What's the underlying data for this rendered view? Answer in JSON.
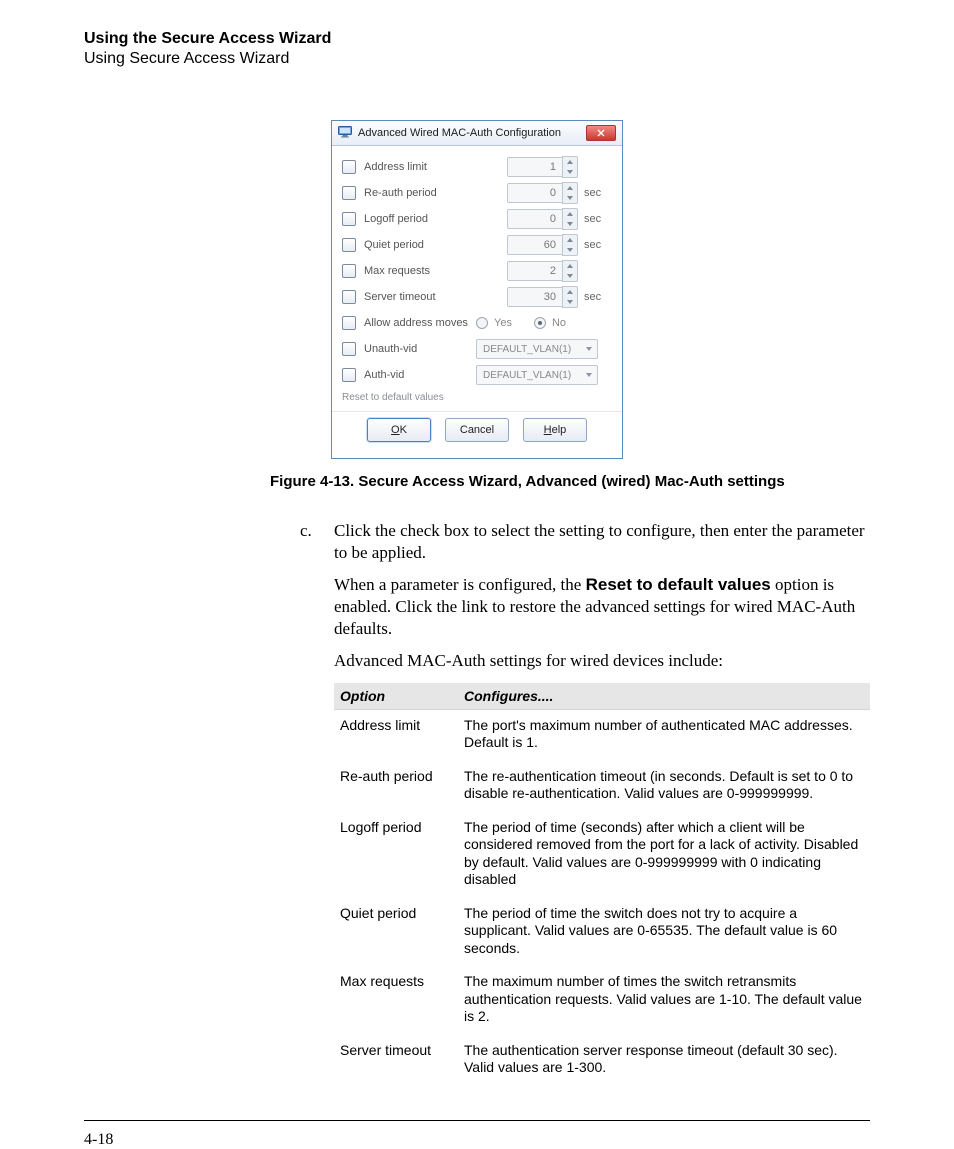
{
  "header": {
    "title_bold": "Using the Secure Access Wizard",
    "title_sub": "Using Secure Access Wizard"
  },
  "dialog": {
    "title": "Advanced Wired MAC-Auth Configuration",
    "rows": {
      "address_limit": {
        "label": "Address limit",
        "value": "1",
        "unit": ""
      },
      "reauth_period": {
        "label": "Re-auth period",
        "value": "0",
        "unit": "sec"
      },
      "logoff_period": {
        "label": "Logoff period",
        "value": "0",
        "unit": "sec"
      },
      "quiet_period": {
        "label": "Quiet period",
        "value": "60",
        "unit": "sec"
      },
      "max_requests": {
        "label": "Max requests",
        "value": "2",
        "unit": ""
      },
      "server_timeout": {
        "label": "Server timeout",
        "value": "30",
        "unit": "sec"
      },
      "allow_moves": {
        "label": "Allow address moves",
        "yes": "Yes",
        "no": "No"
      },
      "unauth_vid": {
        "label": "Unauth-vid",
        "value": "DEFAULT_VLAN(1)"
      },
      "auth_vid": {
        "label": "Auth-vid",
        "value": "DEFAULT_VLAN(1)"
      }
    },
    "reset_link": "Reset to default values",
    "buttons": {
      "ok": "OK",
      "cancel": "Cancel",
      "help": "Help"
    }
  },
  "figure_caption": "Figure 4-13. Secure Access Wizard, Advanced (wired) Mac-Auth settings",
  "body": {
    "list_marker": "c.",
    "p1a": "Click the check box to select the setting to configure, then enter the parameter to be applied.",
    "p2_pre": "When a parameter is configured, the ",
    "p2_bold": "Reset to default values",
    "p2_post": " option is enabled. Click the link to restore the advanced settings for wired MAC-Auth defaults.",
    "p3": "Advanced MAC-Auth settings for wired devices include:"
  },
  "table": {
    "h1": "Option",
    "h2": "Configures....",
    "rows": [
      {
        "opt": "Address limit",
        "desc": "The port's maximum number of authenticated MAC addresses. Default is 1."
      },
      {
        "opt": "Re-auth period",
        "desc": "The re-authentication timeout (in seconds. Default is set to 0 to disable re-authentication. Valid values are 0-999999999."
      },
      {
        "opt": "Logoff period",
        "desc": "The period of time (seconds) after which a client will be considered removed from the port for a lack of activity. Disabled by default. Valid values are 0-999999999 with 0 indicating disabled"
      },
      {
        "opt": "Quiet period",
        "desc": "The period of time the switch does not try to acquire a supplicant. Valid values are 0-65535. The default value is 60 seconds."
      },
      {
        "opt": "Max requests",
        "desc": "The maximum number of times the switch retransmits authentication requests. Valid values are 1-10. The default value is 2."
      },
      {
        "opt": "Server timeout",
        "desc": "The authentication server response timeout (default 30 sec). Valid values are 1-300."
      }
    ]
  },
  "pagenum": "4-18"
}
